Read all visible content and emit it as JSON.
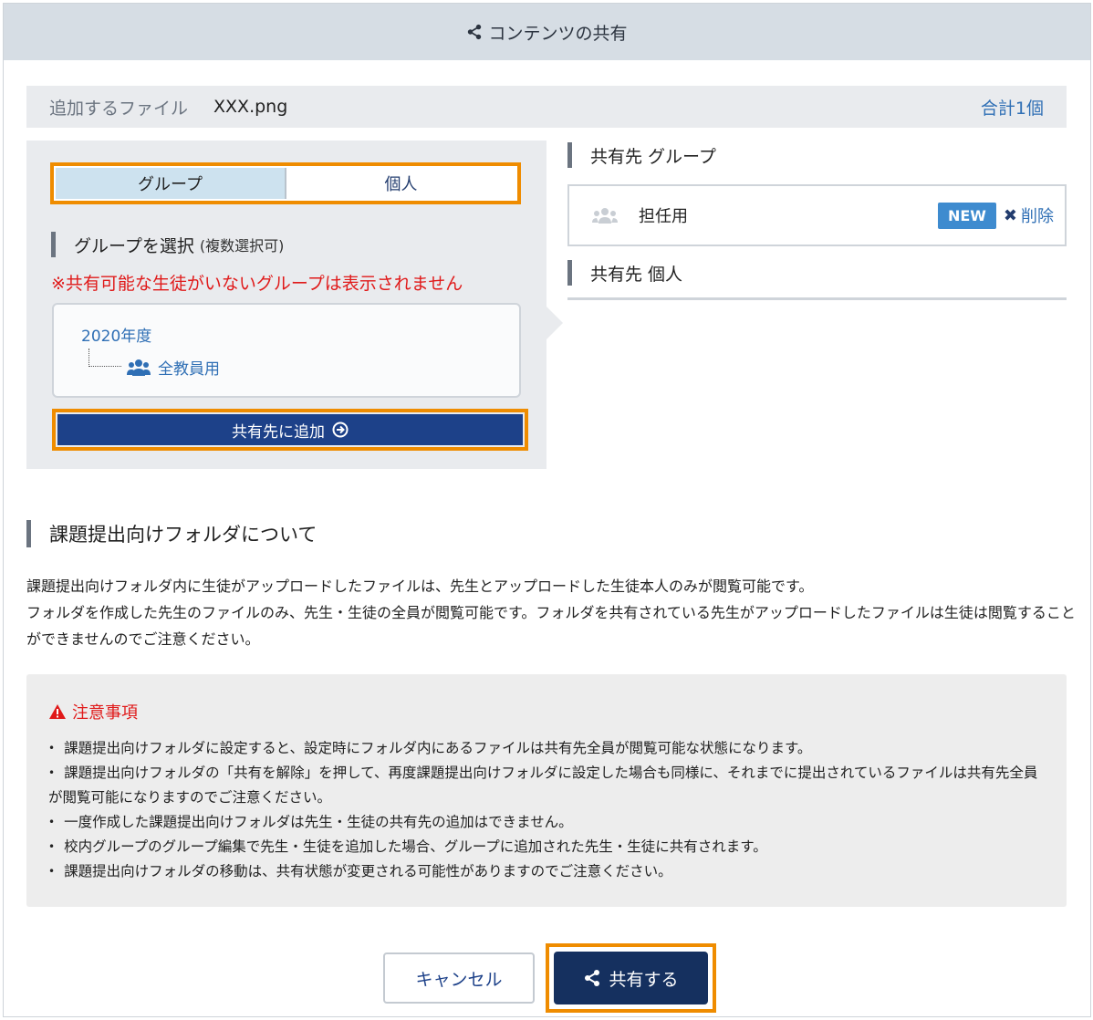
{
  "header": {
    "title": "コンテンツの共有",
    "icon": "share-icon"
  },
  "file_bar": {
    "label": "追加するファイル",
    "filename": "XXX.png",
    "total": "合計1個"
  },
  "tabs": {
    "group_label": "グループ",
    "individual_label": "個人",
    "active": "group"
  },
  "group_select": {
    "title": "グループを選択",
    "subtitle": "(複数選択可)",
    "warning": "※共有可能な生徒がいないグループは表示されません",
    "tree": {
      "year": "2020年度",
      "item": "全教員用",
      "item_icon": "users-icon"
    },
    "add_button": "共有先に追加",
    "add_icon": "arrow-circle-right-icon"
  },
  "share_targets": {
    "group_title": "共有先 グループ",
    "groups": [
      {
        "name": "担任用",
        "badge": "NEW",
        "remove": "削除"
      }
    ],
    "individual_title": "共有先 個人"
  },
  "about": {
    "title": "課題提出向けフォルダについて",
    "lines": [
      "課題提出向けフォルダ内に生徒がアップロードしたファイルは、先生とアップロードした生徒本人のみが閲覧可能です。",
      "フォルダを作成した先生のファイルのみ、先生・生徒の全員が閲覧可能です。フォルダを共有されている先生がアップロードしたファイルは生徒は閲覧することができませんのでご注意ください。"
    ]
  },
  "notice": {
    "title": "注意事項",
    "icon": "warning-icon",
    "items": [
      "課題提出向けフォルダに設定すると、設定時にフォルダ内にあるファイルは共有先全員が閲覧可能な状態になります。",
      "課題提出向けフォルダの「共有を解除」を押して、再度課題提出向けフォルダに設定した場合も同様に、それまでに提出されているファイルは共有先全員が閲覧可能になりますのでご注意ください。",
      "一度作成した課題提出向けフォルダは先生・生徒の共有先の追加はできません。",
      "校内グループのグループ編集で先生・生徒を追加した場合、グループに追加された先生・生徒に共有されます。",
      "課題提出向けフォルダの移動は、共有状態が変更される可能性がありますのでご注意ください。"
    ]
  },
  "footer": {
    "cancel": "キャンセル",
    "share": "共有する"
  },
  "colors": {
    "highlight": "#ef8c00",
    "primary": "#1d4189",
    "link": "#2f6fb5",
    "warning": "#e01a1a",
    "badge": "#3e8bcf"
  }
}
